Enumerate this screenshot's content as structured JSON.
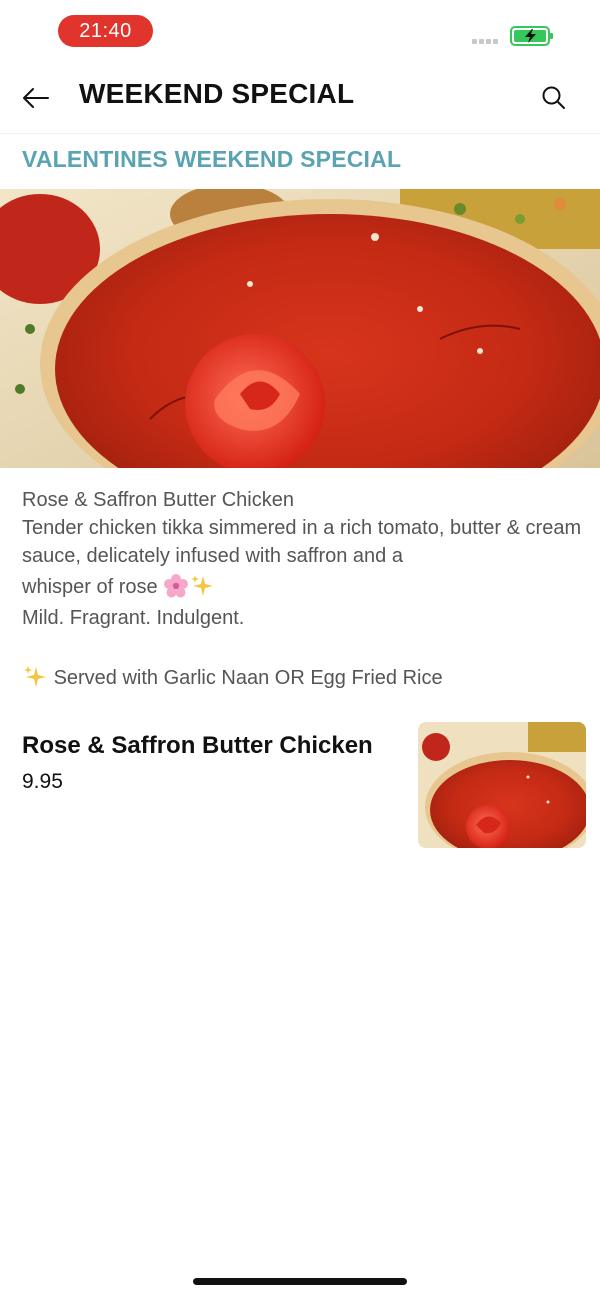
{
  "status_bar": {
    "time": "21:40",
    "battery_icon": "battery-charging-icon",
    "signal_icon": "signal-dots-icon",
    "accent_time_bg": "#e0342c",
    "battery_color": "#34c759"
  },
  "header": {
    "back_icon": "arrow-left-icon",
    "title": "WEEKEND SPECIAL",
    "search_icon": "search-icon"
  },
  "category": {
    "title": "VALENTINES WEEKEND SPECIAL",
    "color": "#5aa3b3"
  },
  "hero": {
    "image_icon": "butter-chicken-photo"
  },
  "description": {
    "line1": "Rose & Saffron Butter Chicken",
    "line2": "Tender chicken tikka simmered in a rich tomato, butter & cream sauce, delicately infused with saffron and a",
    "line3": "whisper of rose",
    "line3_emojis": [
      "cherry-blossom-icon",
      "sparkles-icon"
    ],
    "line4": "Mild. Fragrant. Indulgent.",
    "line5": "Served with Garlic Naan OR Egg Fried Rice",
    "line5_emoji": "sparkles-icon"
  },
  "menu_items": [
    {
      "name": "Rose & Saffron Butter Chicken",
      "price": "9.95",
      "thumb_icon": "butter-chicken-thumbnail"
    }
  ]
}
